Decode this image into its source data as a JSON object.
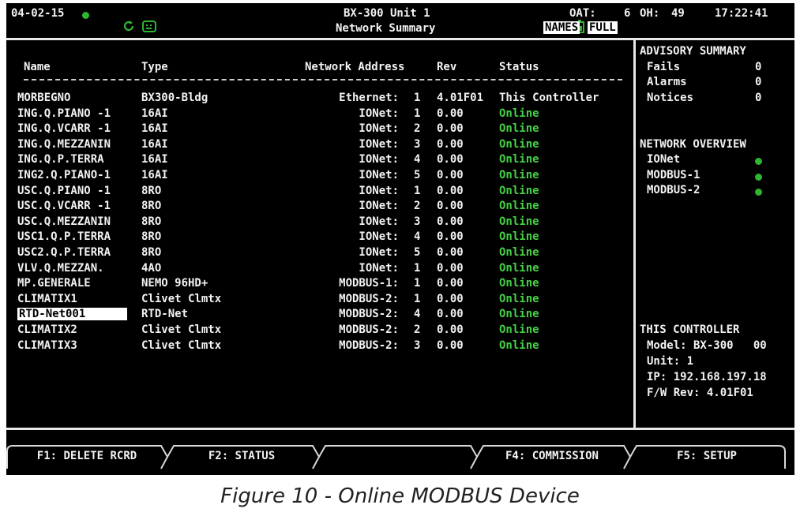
{
  "header": {
    "date": "04-02-15",
    "unit_title": "BX-300 Unit 1",
    "subtitle": "Network Summary",
    "oat_label": "OAT:",
    "oat_value": "6",
    "oh_label": "OH:",
    "oh_value": "49",
    "time": "17:22:41",
    "names_tag": "NAMES",
    "full_tag": "FULL"
  },
  "table": {
    "headers": {
      "name": "Name",
      "type": "Type",
      "address": "Network Address",
      "rev": "Rev",
      "status": "Status"
    },
    "rows": [
      {
        "name": "MORBEGNO",
        "type": "BX300-Bldg",
        "net": "Ethernet:",
        "num": "1",
        "rev": "4.01F01",
        "status": "This Controller"
      },
      {
        "name": "ING.Q.PIANO -1",
        "type": "16AI",
        "net": "IONet:",
        "num": "1",
        "rev": "0.00",
        "status": "Online"
      },
      {
        "name": "ING.Q.VCARR -1",
        "type": "16AI",
        "net": "IONet:",
        "num": "2",
        "rev": "0.00",
        "status": "Online"
      },
      {
        "name": "ING.Q.MEZZANIN",
        "type": "16AI",
        "net": "IONet:",
        "num": "3",
        "rev": "0.00",
        "status": "Online"
      },
      {
        "name": "ING.Q.P.TERRA",
        "type": "16AI",
        "net": "IONet:",
        "num": "4",
        "rev": "0.00",
        "status": "Online"
      },
      {
        "name": "ING2.Q.PIANO-1",
        "type": "16AI",
        "net": "IONet:",
        "num": "5",
        "rev": "0.00",
        "status": "Online"
      },
      {
        "name": "USC.Q.PIANO -1",
        "type": "8RO",
        "net": "IONet:",
        "num": "1",
        "rev": "0.00",
        "status": "Online"
      },
      {
        "name": "USC.Q.VCARR -1",
        "type": "8RO",
        "net": "IONet:",
        "num": "2",
        "rev": "0.00",
        "status": "Online"
      },
      {
        "name": "USC.Q.MEZZANIN",
        "type": "8RO",
        "net": "IONet:",
        "num": "3",
        "rev": "0.00",
        "status": "Online"
      },
      {
        "name": "USC1.Q.P.TERRA",
        "type": "8RO",
        "net": "IONet:",
        "num": "4",
        "rev": "0.00",
        "status": "Online"
      },
      {
        "name": "USC2.Q.P.TERRA",
        "type": "8RO",
        "net": "IONet:",
        "num": "5",
        "rev": "0.00",
        "status": "Online"
      },
      {
        "name": "VLV.Q.MEZZAN.",
        "type": "4AO",
        "net": "IONet:",
        "num": "1",
        "rev": "0.00",
        "status": "Online"
      },
      {
        "name": "MP.GENERALE",
        "type": "NEMO 96HD+",
        "net": "MODBUS-1:",
        "num": "1",
        "rev": "0.00",
        "status": "Online"
      },
      {
        "name": "CLIMATIX1",
        "type": "Clivet Clmtx",
        "net": "MODBUS-2:",
        "num": "1",
        "rev": "0.00",
        "status": "Online"
      },
      {
        "name": "RTD-Net001",
        "type": "RTD-Net",
        "net": "MODBUS-2:",
        "num": "4",
        "rev": "0.00",
        "status": "Online",
        "selected": true
      },
      {
        "name": "CLIMATIX2",
        "type": "Clivet Clmtx",
        "net": "MODBUS-2:",
        "num": "2",
        "rev": "0.00",
        "status": "Online"
      },
      {
        "name": "CLIMATIX3",
        "type": "Clivet Clmtx",
        "net": "MODBUS-2:",
        "num": "3",
        "rev": "0.00",
        "status": "Online"
      }
    ]
  },
  "advisory": {
    "title": "ADVISORY SUMMARY",
    "fails_label": "Fails",
    "fails_value": "0",
    "alarms_label": "Alarms",
    "alarms_value": "0",
    "notices_label": "Notices",
    "notices_value": "0"
  },
  "network_overview": {
    "title": "NETWORK OVERVIEW",
    "items": [
      "IONet",
      "MODBUS-1",
      "MODBUS-2"
    ],
    "status_color": "#2fb52f"
  },
  "this_controller": {
    "title": "THIS CONTROLLER",
    "model": "Model: BX-300   00",
    "unit": "Unit: 1",
    "ip": "IP: 192.168.197.18",
    "fw": "F/W Rev: 4.01F01"
  },
  "function_keys": [
    "F1: DELETE RCRD",
    "F2: STATUS",
    "",
    "F4: COMMISSION",
    "F5: SETUP"
  ],
  "caption": "Figure 10 - Online MODBUS Device",
  "colors": {
    "online": "#46d046",
    "status_dot": "#2fb52f",
    "background": "#000000"
  },
  "icons": [
    "status-dot-icon",
    "refresh-icon",
    "grid-icon",
    "battery-icon"
  ]
}
